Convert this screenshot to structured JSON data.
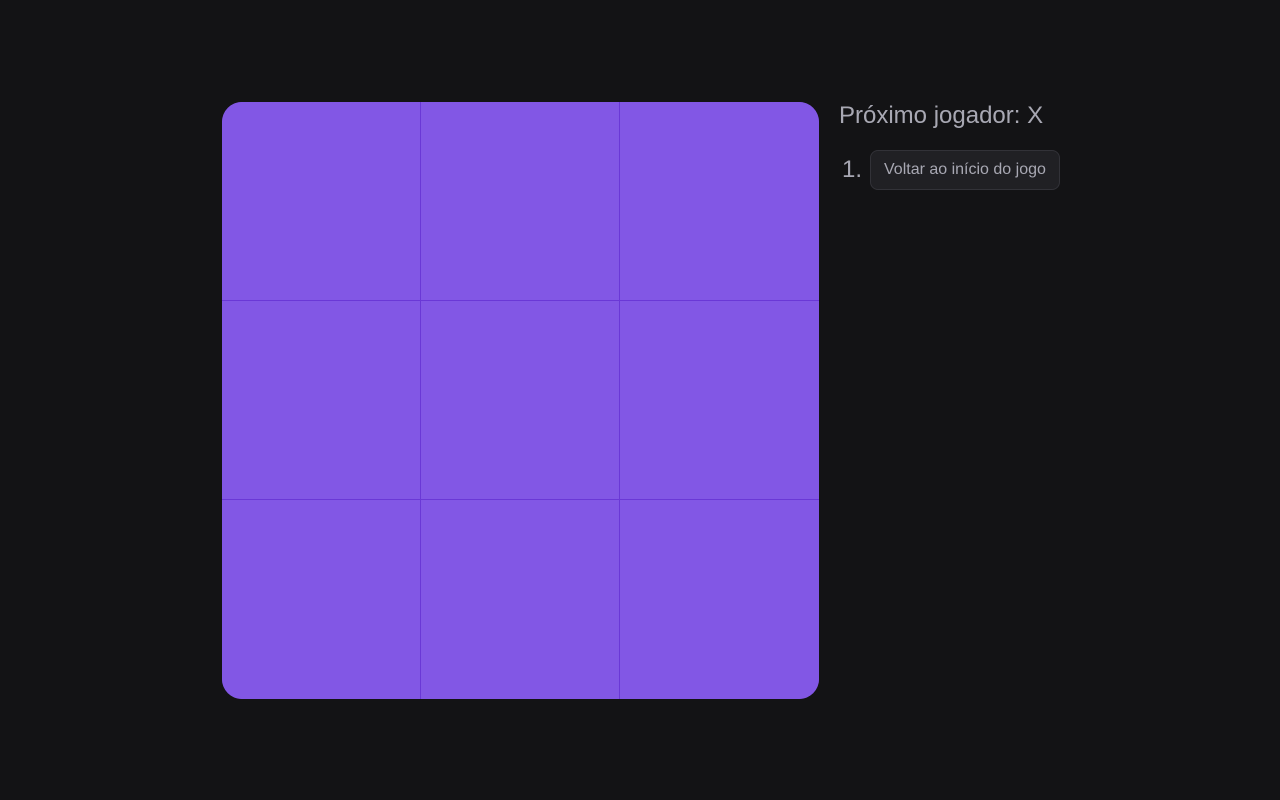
{
  "board": {
    "squares": [
      "",
      "",
      "",
      "",
      "",
      "",
      "",
      "",
      ""
    ],
    "color": "#8257e5",
    "line_color": "#6a38d6"
  },
  "info": {
    "status": "Próximo jogador: X",
    "moves": [
      {
        "number": "1.",
        "label": "Voltar ao início do jogo"
      }
    ]
  },
  "theme": {
    "background": "#131315",
    "text": "#a8a8b3",
    "button_bg": "#202024"
  }
}
